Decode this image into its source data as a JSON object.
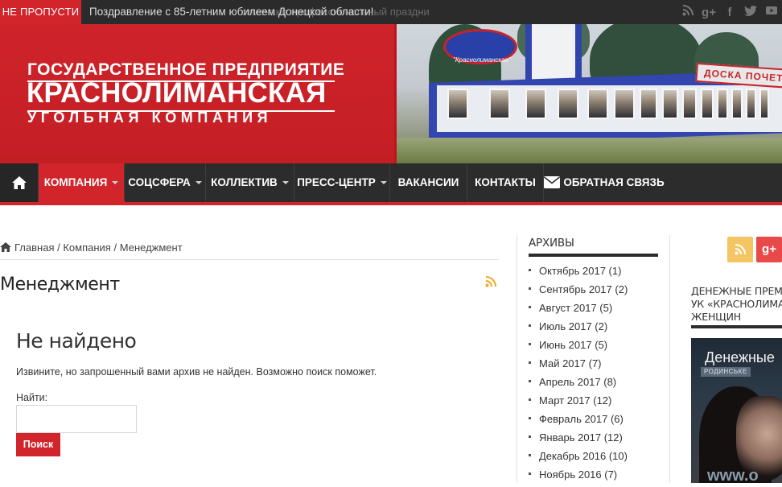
{
  "topbar": {
    "ticker_label": "НЕ ПРОПУСТИ",
    "ticker_text": "Поздравление с 85-летним юбилеем Донецкой области!",
    "ticker_ghost": "отмечают профессиональный праздни",
    "social_icons": [
      "rss-icon",
      "google-plus-icon",
      "facebook-icon",
      "twitter-icon",
      "youtube-icon"
    ]
  },
  "header": {
    "logo_line1": "ГОСУДАРСТВЕННОЕ ПРЕДПРИЯТИЕ",
    "logo_line2": "КРАСНОЛИМАНСКАЯ",
    "logo_line3": "УГОЛЬНАЯ КОМПАНИЯ",
    "photo_emblem_text": "\"Краснолиманская\"",
    "photo_sign_text": "ДОСКА ПОЧЕТА"
  },
  "nav": {
    "items": [
      {
        "label": "КОМПАНИЯ",
        "dropdown": true,
        "active": true
      },
      {
        "label": "СОЦСФЕРА",
        "dropdown": true
      },
      {
        "label": "КОЛЛЕКТИВ",
        "dropdown": true
      },
      {
        "label": "ПРЕСС-ЦЕНТР",
        "dropdown": true
      },
      {
        "label": "ВАКАНСИИ",
        "dropdown": false
      },
      {
        "label": "КОНТАКТЫ",
        "dropdown": false
      },
      {
        "label": "ОБРАТНАЯ СВЯЗЬ",
        "dropdown": false
      }
    ]
  },
  "breadcrumb": {
    "home": "Главная",
    "sep": "/",
    "section": "Компания",
    "current": "Менеджмент"
  },
  "main": {
    "page_title": "Менеджмент",
    "not_found_title": "Не найдено",
    "not_found_text": "Извините, но запрошенный вами архив не найден. Возможно поиск поможет.",
    "search_label": "Найти:",
    "search_value": "",
    "search_button": "Поиск"
  },
  "archives": {
    "title": "АРХИВЫ",
    "items": [
      "Октябрь 2017 (1)",
      "Сентябрь 2017 (2)",
      "Август 2017 (5)",
      "Июль 2017 (2)",
      "Июнь 2017 (5)",
      "Май 2017 (7)",
      "Апрель 2017 (8)",
      "Март 2017 (12)",
      "Февраль 2017 (6)",
      "Январь 2017 (12)",
      "Декабрь 2016 (10)",
      "Ноябрь 2016 (7)"
    ]
  },
  "right": {
    "rss_symbol": "◉",
    "gplus_symbol": "g+",
    "widget_title_line1": "ДЕНЕЖНЫЕ ПРЕМИ",
    "widget_title_line2": "УК «КРАСНОЛИМАН",
    "widget_title_line3": "ЖЕНЩИН",
    "video_title": "Денежные",
    "video_sub": "РОДИНСЬКЕ",
    "video_watermark": "www.o"
  },
  "colors": {
    "brand_red": "#d2242b",
    "nav_dark": "#2c2c2c",
    "rss_orange": "#f5b542",
    "gplus_red": "#e84a4a"
  }
}
